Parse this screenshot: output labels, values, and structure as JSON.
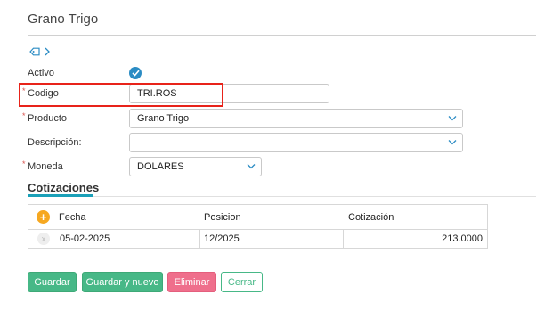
{
  "page": {
    "title": "Grano Trigo"
  },
  "form": {
    "activo_label": "Activo",
    "activo_checked": true,
    "required_mark": "*",
    "codigo_label": "Codigo",
    "codigo_value": "TRI.ROS",
    "producto_label": "Producto",
    "producto_value": "Grano Trigo",
    "descripcion_label": "Descripción:",
    "descripcion_value": "",
    "moneda_label": "Moneda",
    "moneda_value": "DOLARES"
  },
  "tabs": [
    {
      "label": "Cotizaciones",
      "active": true
    }
  ],
  "grid": {
    "columns": [
      "Fecha",
      "Posicion",
      "Cotización"
    ],
    "add_icon": "+",
    "remove_icon": "x",
    "rows": [
      {
        "fecha": "05-02-2025",
        "posicion": "12/2025",
        "cotizacion": "213.0000"
      }
    ]
  },
  "buttons": {
    "guardar": "Guardar",
    "guardar_nuevo": "Guardar y nuevo",
    "eliminar": "Eliminar",
    "cerrar": "Cerrar"
  },
  "colors": {
    "accent": "#2b8cc4",
    "highlight_box": "#e8231a",
    "success": "#47b887",
    "danger": "#ef6f8c",
    "tab_underline": "#1aa0b8",
    "add_button": "#f6a821"
  }
}
